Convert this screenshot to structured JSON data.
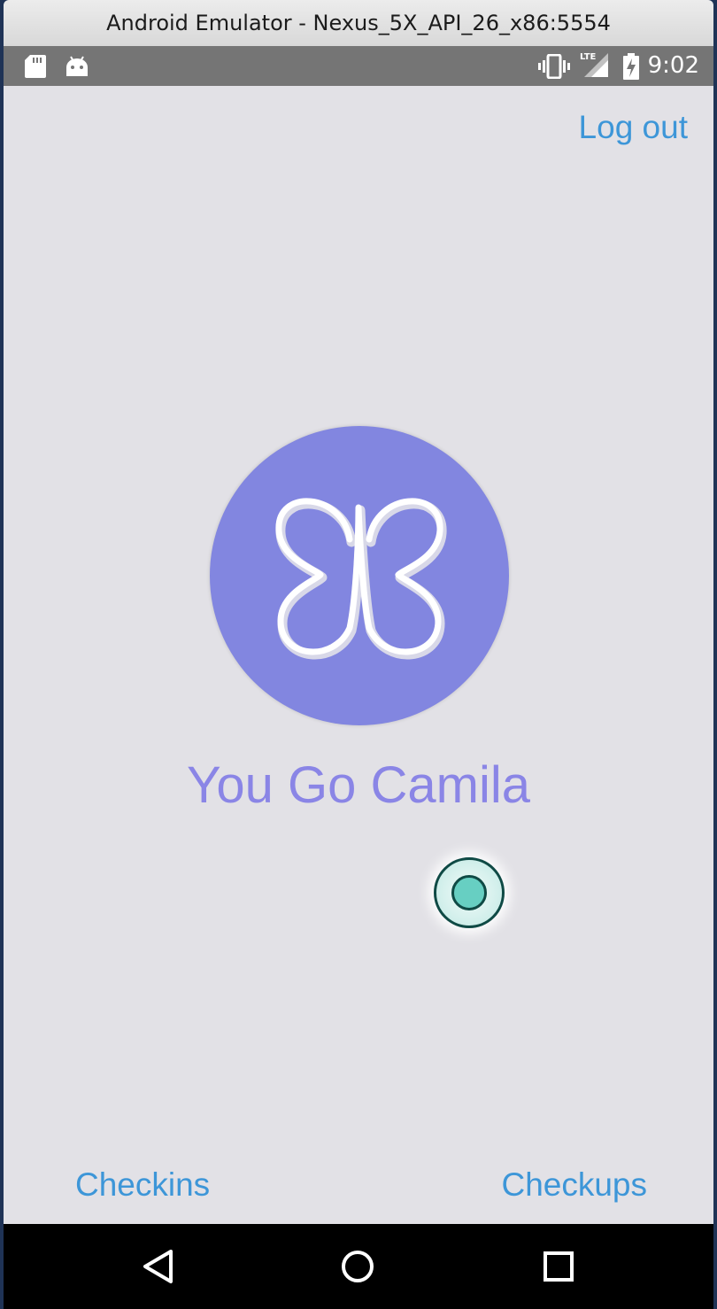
{
  "window": {
    "title": "Android Emulator - Nexus_5X_API_26_x86:5554"
  },
  "status_bar": {
    "time": "9:02",
    "network_label": "LTE",
    "icons": [
      "sd-card-icon",
      "android-icon",
      "vibrate-icon",
      "lte-signal-icon",
      "battery-charging-icon"
    ]
  },
  "app": {
    "logout_label": "Log out",
    "greeting": "You Go Camila",
    "logo_color": "#8286e0",
    "accent_color": "#3d96d8",
    "tabs": {
      "left": "Checkins",
      "right": "Checkups"
    },
    "record_button_color": "#67cfc2"
  },
  "nav_bar": {
    "buttons": [
      "back-icon",
      "home-icon",
      "recents-icon"
    ]
  }
}
